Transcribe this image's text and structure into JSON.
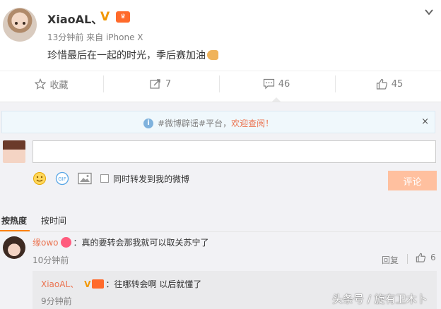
{
  "post": {
    "username": "XiaoAL、",
    "v_badge": "V",
    "time": "13分钟前",
    "source_prefix": "来自",
    "device": "iPhone X",
    "text": "珍惜最后在一起的时光，季后赛加油"
  },
  "actions": {
    "favorite": "收藏",
    "forward_count": "7",
    "comment_count": "46",
    "like_count": "45"
  },
  "notice": {
    "text": "#微博辟谣#平台，",
    "link": "欢迎查阅！",
    "close": "×"
  },
  "composer": {
    "input_value": "",
    "forward_label": "同时转发到我的微博",
    "submit_label": "评论"
  },
  "sort": {
    "hot": "按热度",
    "time": "按时间"
  },
  "comments": [
    {
      "user": "缘owo",
      "text": "：真的要转会那我就可以取关苏宁了",
      "time": "10分钟前",
      "reply_label": "回复",
      "likes": "6",
      "reply": {
        "user": "XiaoAL、",
        "v_badge": "V",
        "text": "：往哪转会啊  以后就懂了",
        "time": "9分钟前"
      }
    }
  ],
  "watermark": "头条号 / 旋有卫木卜",
  "colors": {
    "accent": "#eb7350",
    "verified": "#f29700",
    "submit_disabled": "#ffc09f"
  }
}
